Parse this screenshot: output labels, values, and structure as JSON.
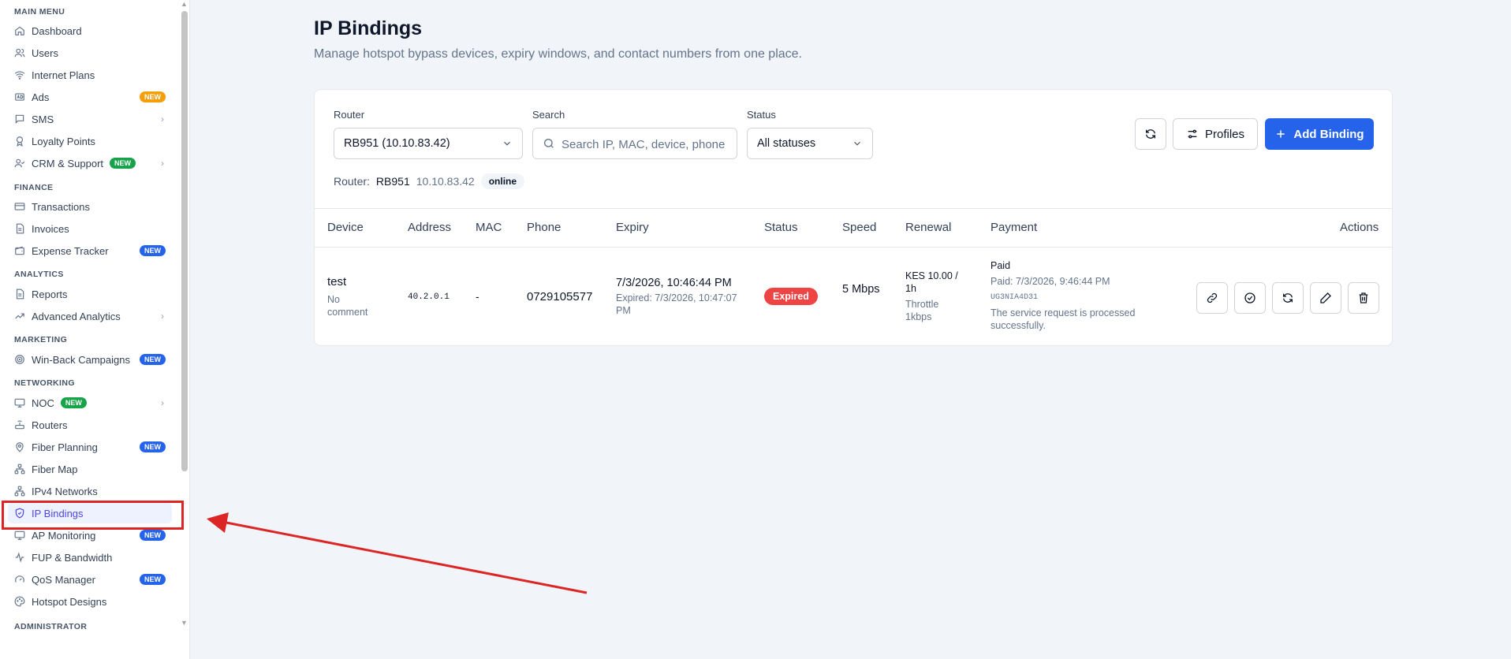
{
  "sidebar": {
    "sections": {
      "main": "MAIN MENU",
      "finance": "FINANCE",
      "analytics": "ANALYTICS",
      "marketing": "MARKETING",
      "networking": "NETWORKING",
      "administrator": "ADMINISTRATOR"
    },
    "items": {
      "dashboard": "Dashboard",
      "users": "Users",
      "internet_plans": "Internet Plans",
      "ads": "Ads",
      "sms": "SMS",
      "loyalty": "Loyalty Points",
      "crm": "CRM & Support",
      "transactions": "Transactions",
      "invoices": "Invoices",
      "expense": "Expense Tracker",
      "reports": "Reports",
      "advanced_analytics": "Advanced Analytics",
      "winback": "Win-Back Campaigns",
      "noc": "NOC",
      "routers": "Routers",
      "fiber_planning": "Fiber Planning",
      "fiber_map": "Fiber Map",
      "ipv4": "IPv4 Networks",
      "ip_bindings": "IP Bindings",
      "ap_monitoring": "AP Monitoring",
      "fup": "FUP & Bandwidth",
      "qos": "QoS Manager",
      "hotspot": "Hotspot Designs"
    },
    "badge_new": "NEW"
  },
  "page": {
    "title": "IP Bindings",
    "subtitle": "Manage hotspot bypass devices, expiry windows, and contact numbers from one place."
  },
  "filters": {
    "router_label": "Router",
    "router_value": "RB951 (10.10.83.42)",
    "search_label": "Search",
    "search_placeholder": "Search IP, MAC, device, phone",
    "status_label": "Status",
    "status_value": "All statuses"
  },
  "router_info": {
    "key": "Router:",
    "name": "RB951",
    "ip": "10.10.83.42",
    "state": "online"
  },
  "toolbar": {
    "profiles": "Profiles",
    "add_binding": "Add Binding"
  },
  "table": {
    "headers": {
      "device": "Device",
      "address": "Address",
      "mac": "MAC",
      "phone": "Phone",
      "expiry": "Expiry",
      "status": "Status",
      "speed": "Speed",
      "renewal": "Renewal",
      "payment": "Payment",
      "actions": "Actions"
    },
    "rows": [
      {
        "device": "test",
        "comment": "No comment",
        "address": "40.2.0.1",
        "mac": "-",
        "phone": "0729105577",
        "expiry": "7/3/2026, 10:46:44 PM",
        "expired_note": "Expired: 7/3/2026, 10:47:07 PM",
        "status": "Expired",
        "speed": "5 Mbps",
        "renewal": "KES 10.00 / 1h",
        "renewal_note": "Throttle 1kbps",
        "payment_status": "Paid",
        "payment_time": "Paid: 7/3/2026, 9:46:44 PM",
        "payment_ref": "UG3NIA4D31",
        "payment_msg": "The service request is processed successfully."
      }
    ]
  },
  "colors": {
    "accent": "#2563eb",
    "danger": "#ef4444",
    "active_nav": "#4f46e5",
    "annotation": "#dc2626"
  }
}
